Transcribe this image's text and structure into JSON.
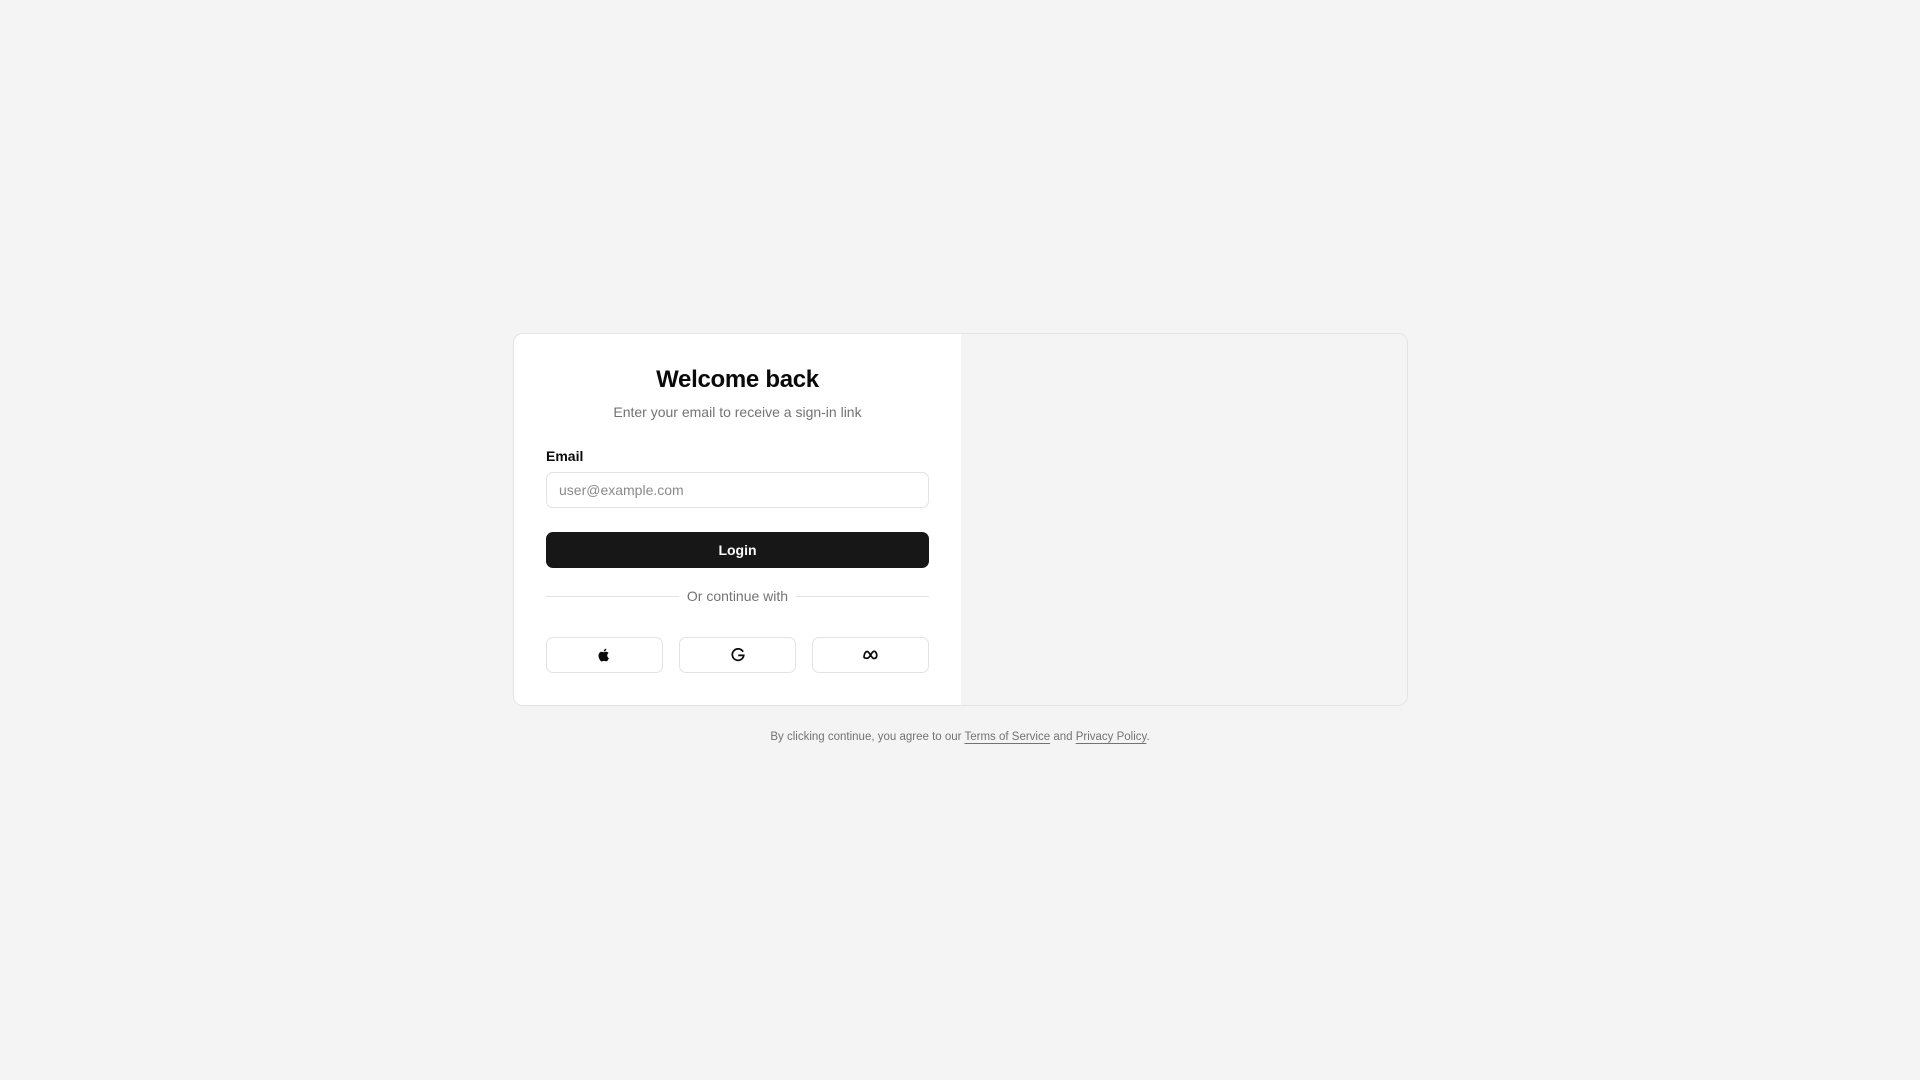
{
  "login": {
    "title": "Welcome back",
    "subtitle": "Enter your email to receive a sign-in link",
    "email_label": "Email",
    "email_placeholder": "user@example.com",
    "email_value": "",
    "login_label": "Login",
    "divider_text": "Or continue with",
    "social": [
      {
        "provider": "Apple",
        "icon": "apple-icon"
      },
      {
        "provider": "Google",
        "icon": "google-icon"
      },
      {
        "provider": "Meta",
        "icon": "meta-icon"
      }
    ]
  },
  "footer": {
    "prefix": "By clicking continue, you agree to our",
    "terms_label": "Terms of Service",
    "and_text": "and",
    "privacy_label": "Privacy Policy",
    "suffix": "."
  },
  "colors": {
    "page_background": "#f4f4f4",
    "card_background": "#ffffff",
    "primary_button": "#171717",
    "muted_text": "#737373",
    "border": "#e3e3e3"
  }
}
